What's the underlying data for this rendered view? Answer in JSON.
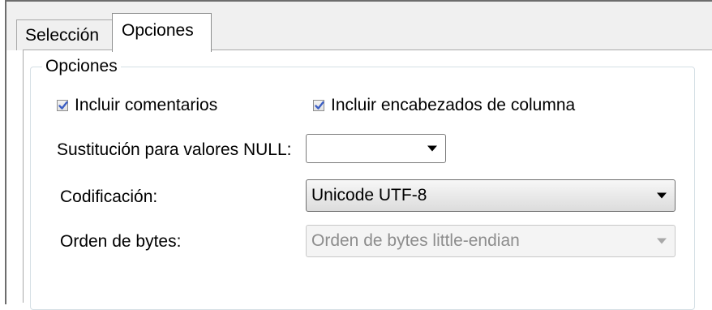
{
  "tabs": [
    {
      "label": "Selección",
      "selected": false
    },
    {
      "label": "Opciones",
      "selected": true
    }
  ],
  "group": {
    "title": "Opciones"
  },
  "options": {
    "include_comments": {
      "label": "Incluir comentarios",
      "checked": true
    },
    "include_headers": {
      "label": "Incluir encabezados de columna",
      "checked": true
    }
  },
  "null_substitution": {
    "label": "Sustitución para valores NULL:",
    "value": ""
  },
  "encoding": {
    "label": "Codificación:",
    "value": "Unicode UTF-8"
  },
  "byte_order": {
    "label": "Orden de bytes:",
    "value": "Orden de bytes little-endian",
    "enabled": false
  },
  "colors": {
    "check_mark": "#3d5fc4",
    "groupbox_border": "#d5dfe5"
  },
  "icons": {
    "dropdown": "chevron-down-icon",
    "check": "check-icon"
  }
}
